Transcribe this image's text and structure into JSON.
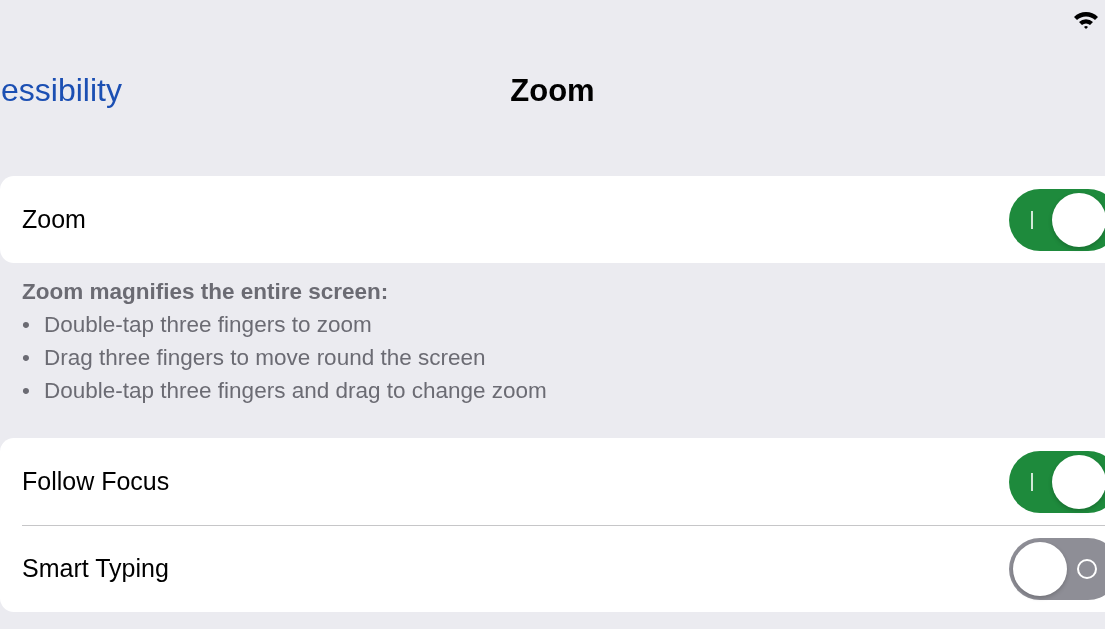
{
  "nav": {
    "back": "essibility",
    "title": "Zoom"
  },
  "groups": [
    {
      "rows": [
        {
          "label": "Zoom",
          "on": true
        }
      ],
      "footer": {
        "heading": "Zoom magnifies the entire screen:",
        "items": [
          {
            "marker": "•",
            "text": "Double-tap three fingers to zoom"
          },
          {
            "marker": "•",
            "text": "Drag three fingers to move round the screen"
          },
          {
            "marker": "•",
            "text": "Double-tap three fingers and drag to change zoom"
          }
        ]
      }
    },
    {
      "rows": [
        {
          "label": "Follow Focus",
          "on": true
        },
        {
          "label": "Smart Typing",
          "on": false
        }
      ]
    }
  ]
}
